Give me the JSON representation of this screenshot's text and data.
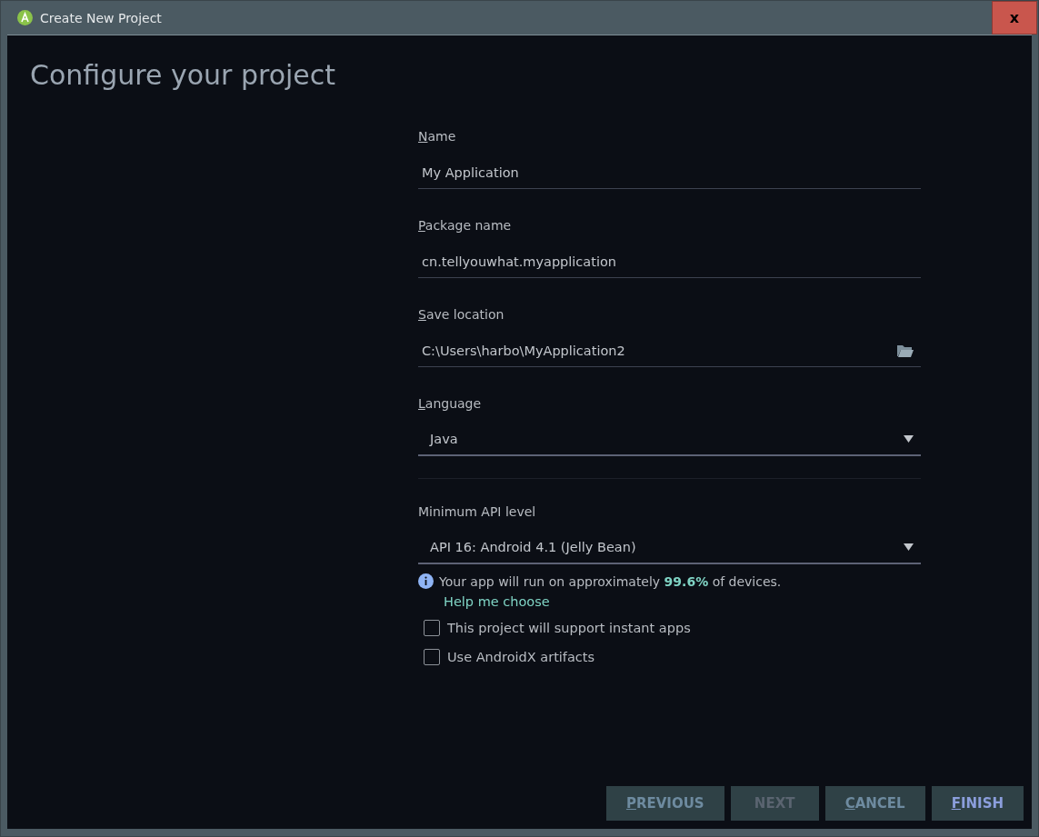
{
  "window": {
    "title": "Create New Project",
    "close": "x"
  },
  "heading": "Configure your project",
  "fields": [
    {
      "kind": "text",
      "label": "Name",
      "mnemonic": true,
      "value": "My Application"
    },
    {
      "kind": "path",
      "label": "Package name",
      "mnemonic": true,
      "value": "cn.tellyouwhat.myapplication"
    },
    {
      "kind": "folder",
      "label": "Save location",
      "mnemonic": true,
      "value": "C:\\Users\\harbo\\MyApplication2"
    },
    {
      "kind": "dropdown",
      "label": "Language",
      "mnemonic": true,
      "value": "Java"
    }
  ],
  "api": {
    "label": "Minimum API level",
    "value": "API 16: Android 4.1 (Jelly Bean)",
    "info": "Your app will run on approximately **99.6%** of devices.",
    "link": "Help me choose"
  },
  "checkboxes": [
    {
      "label": "This project will support instant apps",
      "checked": false
    },
    {
      "label": "Use AndroidX artifacts",
      "checked": false
    }
  ],
  "buttons": [
    {
      "label": "PREVIOUS",
      "mnemonic": true,
      "disabled": false
    },
    {
      "label": "NEXT",
      "mnemonic": false,
      "disabled": true
    },
    {
      "label": "CANCEL",
      "mnemonic": true,
      "disabled": false
    },
    {
      "label": "FINISH",
      "mnemonic": true,
      "disabled": false,
      "primary": true
    }
  ]
}
